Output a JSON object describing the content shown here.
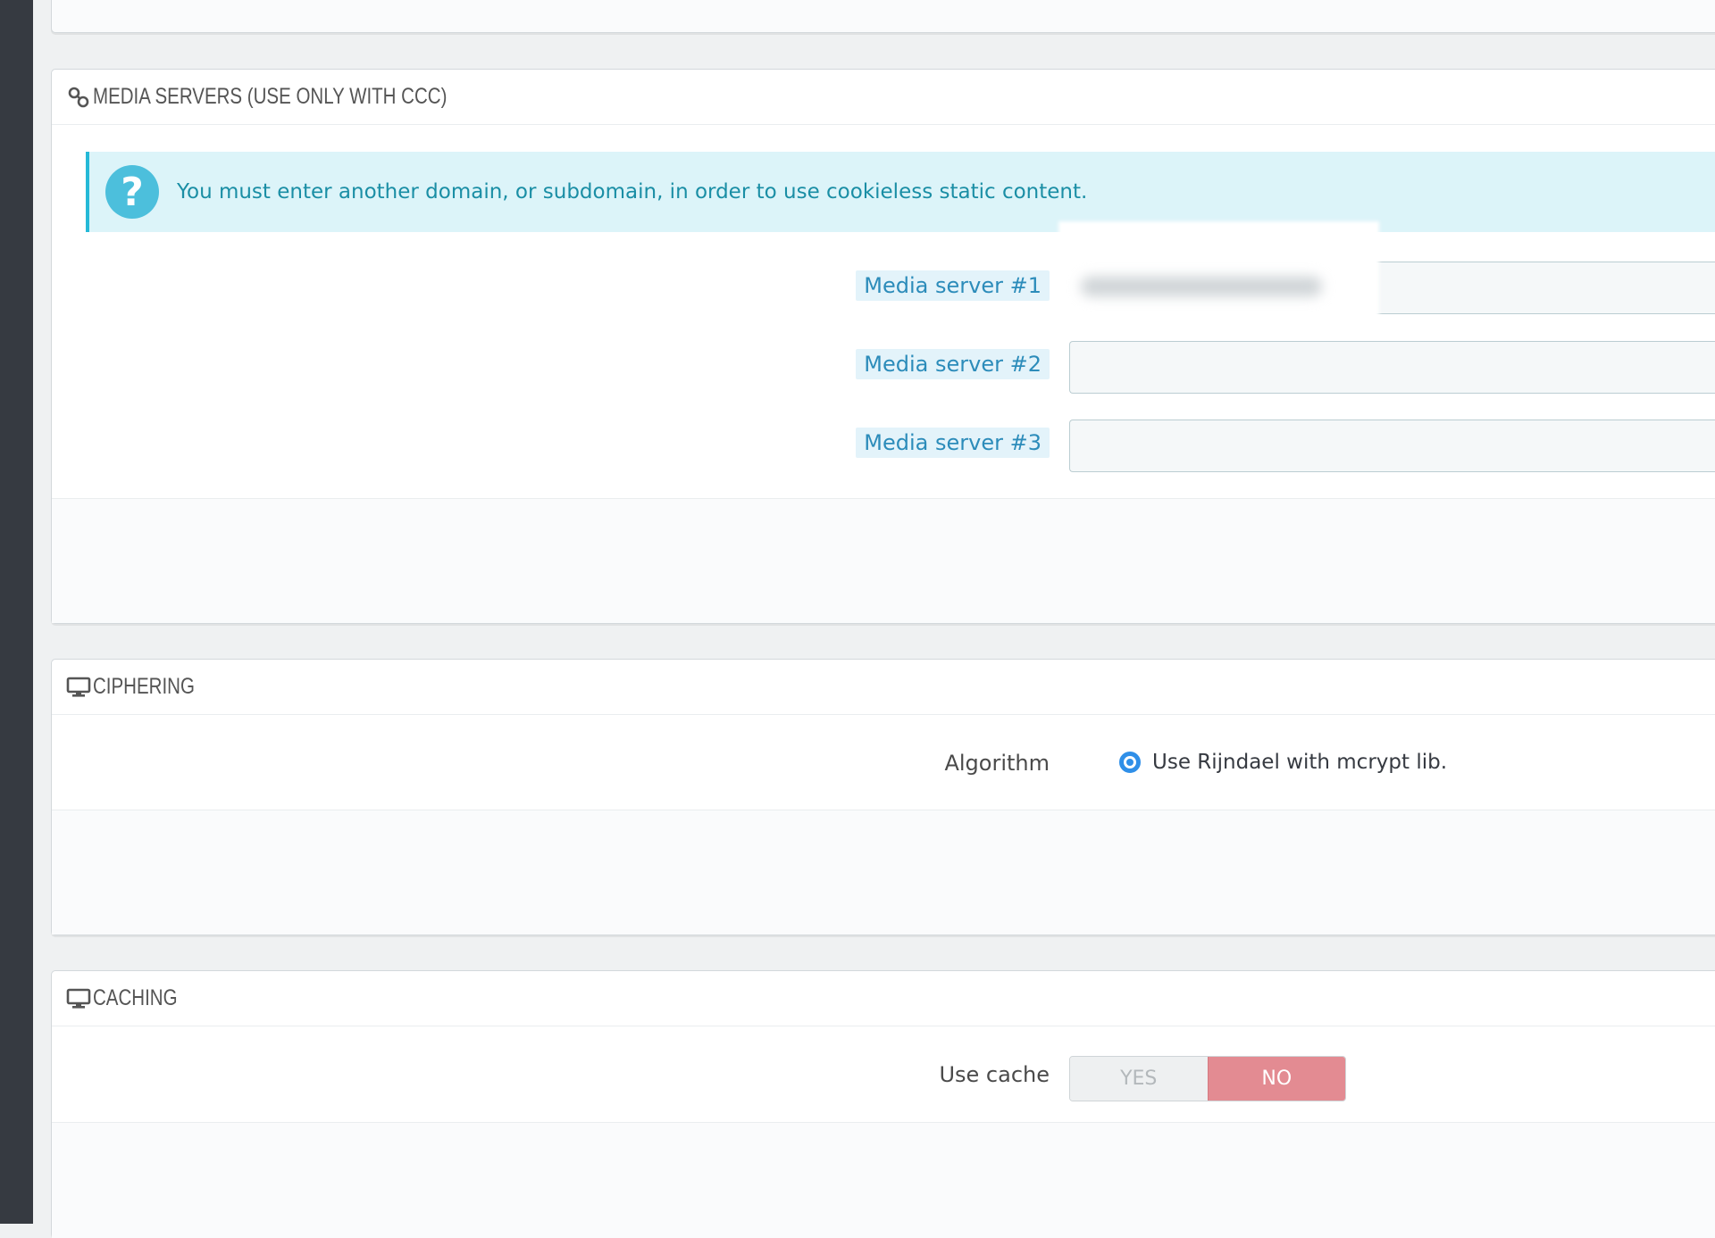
{
  "media_servers": {
    "title": "MEDIA SERVERS (USE ONLY WITH CCC)",
    "icon": "link-icon",
    "alert": {
      "icon": "question-circle-icon",
      "text": "You must enter another domain, or subdomain, in order to use cookieless static content."
    },
    "fields": [
      {
        "label": "Media server #1",
        "value": ""
      },
      {
        "label": "Media server #2",
        "value": ""
      },
      {
        "label": "Media server #3",
        "value": ""
      }
    ]
  },
  "ciphering": {
    "title": "CIPHERING",
    "icon": "desktop-icon",
    "algorithm_label": "Algorithm",
    "algorithm_option": "Use Rijndael with mcrypt lib."
  },
  "caching": {
    "title": "CACHING",
    "icon": "desktop-icon",
    "use_cache_label": "Use cache",
    "yes_label": "YES",
    "no_label": "NO",
    "selected": "NO"
  },
  "colors": {
    "sidebar": "#363a41",
    "alert_bg": "#dcf4f9",
    "alert_accent": "#25b9d7",
    "label_tag_bg": "#e3f3fa",
    "label_tag_text": "#2c8cba",
    "radio_blue": "#2f8fe8",
    "switch_no": "#e38b92"
  }
}
